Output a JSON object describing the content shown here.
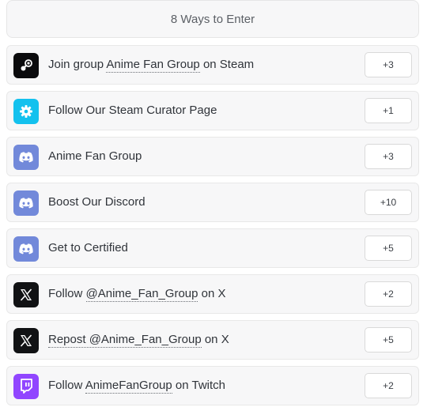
{
  "header": {
    "title": "8 Ways to Enter"
  },
  "entries": [
    {
      "icon": "steam-icon",
      "icon_bg": "#0b0b0d",
      "prefix": "Join group ",
      "link": "Anime Fan Group",
      "suffix": " on Steam",
      "points": "+3"
    },
    {
      "icon": "gear-icon",
      "icon_bg": "#13c1ee",
      "prefix": "Follow Our Steam Curator Page",
      "link": "",
      "suffix": "",
      "points": "+1"
    },
    {
      "icon": "discord-icon",
      "icon_bg": "#7289da",
      "prefix": "Anime Fan Group",
      "link": "",
      "suffix": "",
      "points": "+3"
    },
    {
      "icon": "discord-icon",
      "icon_bg": "#7289da",
      "prefix": "Boost Our Discord",
      "link": "",
      "suffix": "",
      "points": "+10"
    },
    {
      "icon": "discord-icon",
      "icon_bg": "#7289da",
      "prefix": "Get to Certified",
      "link": "",
      "suffix": "",
      "points": "+5"
    },
    {
      "icon": "x-icon",
      "icon_bg": "#111214",
      "prefix": "Follow ",
      "link": "@Anime_Fan_Group",
      "suffix": " on X",
      "points": "+2"
    },
    {
      "icon": "x-icon",
      "icon_bg": "#111214",
      "prefix": "",
      "link": "Repost @Anime_Fan_Group",
      "suffix": " on X",
      "points": "+5"
    },
    {
      "icon": "twitch-icon",
      "icon_bg": "#9146ff",
      "prefix": "Follow ",
      "link": "AnimeFanGroup",
      "suffix": " on Twitch",
      "points": "+2"
    }
  ]
}
